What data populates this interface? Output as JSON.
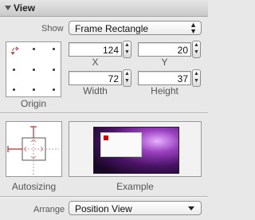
{
  "section": {
    "title": "View"
  },
  "show": {
    "label": "Show",
    "value": "Frame Rectangle"
  },
  "origin": {
    "label": "Origin"
  },
  "x_field": {
    "value": "124",
    "label": "X"
  },
  "y_field": {
    "value": "20",
    "label": "Y"
  },
  "width_field": {
    "value": "72",
    "label": "Width"
  },
  "height_field": {
    "value": "37",
    "label": "Height"
  },
  "autosizing": {
    "label": "Autosizing"
  },
  "example": {
    "label": "Example"
  },
  "arrange": {
    "label": "Arrange",
    "value": "Position View"
  },
  "colors": {
    "strut": "#b03030",
    "marker": "#d00000"
  }
}
